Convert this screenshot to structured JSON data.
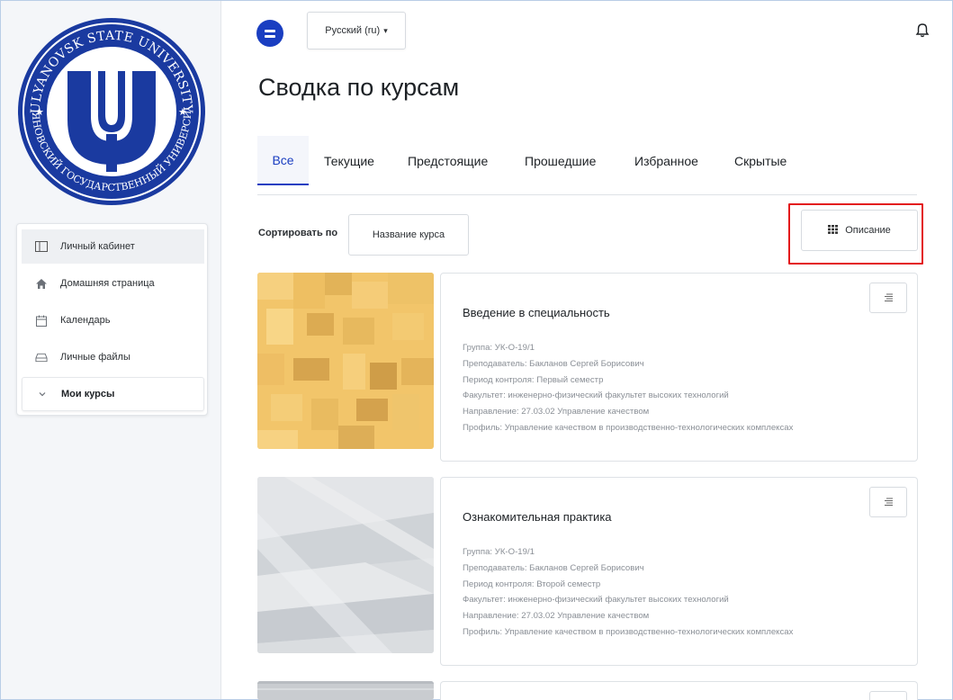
{
  "logo": {
    "top_text": "ULYANOVSK STATE UNIVERSITY",
    "bottom_text": "УЛЬЯНОВСКИЙ ГОСУДАРСТВЕННЫЙ УНИВЕРСИТЕТ",
    "color": "#1a3aa0"
  },
  "nav": {
    "items": [
      {
        "label": "Личный кабинет",
        "icon": "dashboard-icon",
        "active": true
      },
      {
        "label": "Домашняя страница",
        "icon": "home-icon"
      },
      {
        "label": "Календарь",
        "icon": "calendar-icon"
      },
      {
        "label": "Личные файлы",
        "icon": "files-icon"
      },
      {
        "label": "Мои курсы",
        "icon": "chevron-down-icon"
      }
    ]
  },
  "topbar": {
    "language": "Русский (ru)",
    "language_caret": "▾"
  },
  "page": {
    "title": "Сводка по курсам"
  },
  "tabs": [
    {
      "label": "Все",
      "active": true
    },
    {
      "label": "Текущие"
    },
    {
      "label": "Предстоящие"
    },
    {
      "label": "Прошедшие"
    },
    {
      "label": "Избранное"
    },
    {
      "label": "Скрытые"
    }
  ],
  "toolbar": {
    "sort_label": "Сортировать по",
    "sort_value": "Название курса",
    "view_label": "Описание"
  },
  "courses": [
    {
      "title": "Введение в специальность",
      "details": [
        "Группа: УК-О-19/1",
        "Преподаватель: Бакланов Сергей Борисович",
        "Период контроля: Первый семестр",
        "Факультет: инженерно-физический факультет высоких технологий",
        "Направление: 27.03.02 Управление качеством",
        "Профиль: Управление качеством в производственно-технологических комплексах"
      ]
    },
    {
      "title": "Ознакомительная практика",
      "details": [
        "Группа: УК-О-19/1",
        "Преподаватель: Бакланов Сергей Борисович",
        "Период контроля: Второй семестр",
        "Факультет: инженерно-физический факультет высоких технологий",
        "Направление: 27.03.02 Управление качеством",
        "Профиль: Управление качеством в производственно-технологических комплексах"
      ]
    }
  ],
  "colors": {
    "accent": "#1a3ec1",
    "highlight": "#e3171c"
  }
}
